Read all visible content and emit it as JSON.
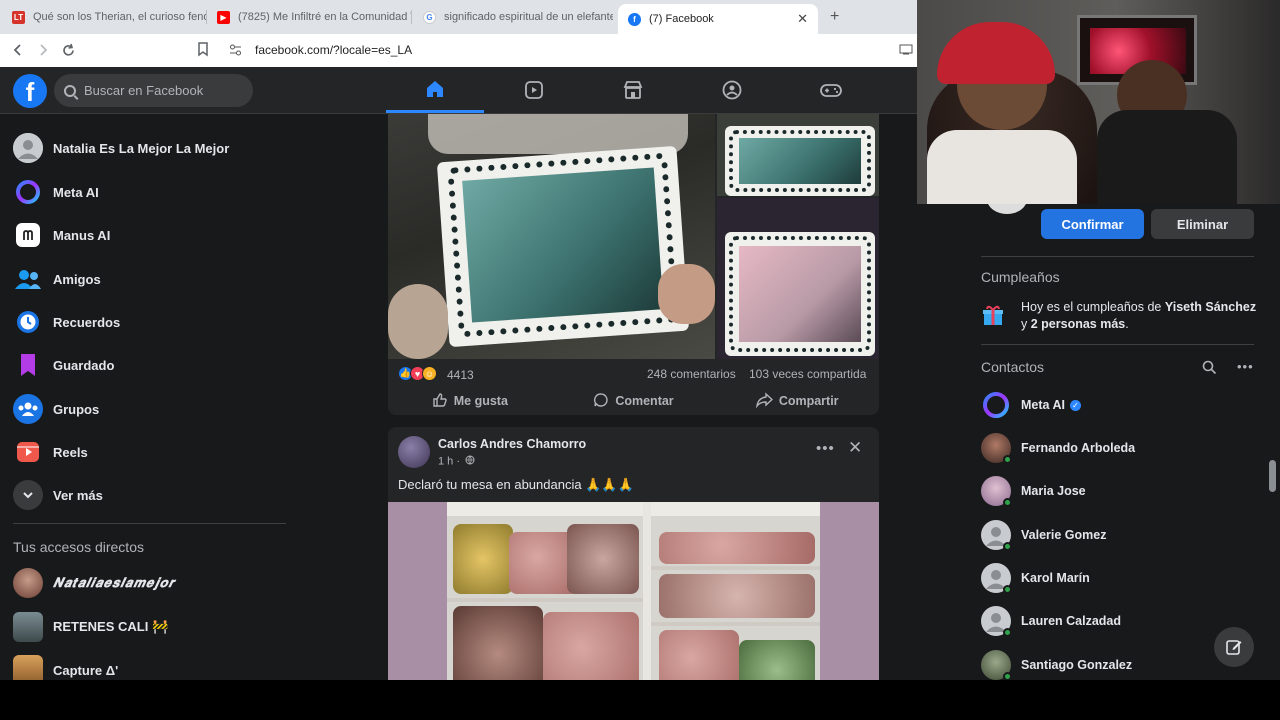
{
  "browser": {
    "tabs": [
      {
        "title": "Qué son los Therian, el curioso fenó",
        "favicon": "LT"
      },
      {
        "title": "(7825) Me Infiltré en la Comunidad T",
        "favicon": "youtube"
      },
      {
        "title": "significado espiritual de un elefante",
        "favicon": "google"
      },
      {
        "title": "(7) Facebook",
        "favicon": "facebook"
      }
    ],
    "url": "facebook.com/?locale=es_LA"
  },
  "fb": {
    "search_placeholder": "Buscar en Facebook",
    "nav": [
      "home-icon",
      "video-icon",
      "marketplace-icon",
      "groups-icon",
      "gaming-icon"
    ]
  },
  "sidebar": {
    "items": [
      {
        "label": "Natalia Es La Mejor La Mejor",
        "icon": "profile-avatar"
      },
      {
        "label": "Meta AI",
        "icon": "meta-ai-icon"
      },
      {
        "label": "Manus AI",
        "icon": "manus-icon"
      },
      {
        "label": "Amigos",
        "icon": "friends-icon"
      },
      {
        "label": "Recuerdos",
        "icon": "memories-icon"
      },
      {
        "label": "Guardado",
        "icon": "saved-icon"
      },
      {
        "label": "Grupos",
        "icon": "groups-icon"
      },
      {
        "label": "Reels",
        "icon": "reels-icon"
      },
      {
        "label": "Ver más",
        "icon": "chevron-down-icon"
      }
    ],
    "shortcuts_heading": "Tus accesos directos",
    "shortcuts": [
      {
        "label": "𝑵𝒂𝒕𝒂𝒍𝒊𝒂𝒆𝒔𝒍𝒂𝒎𝒆𝒋𝒐𝒓"
      },
      {
        "label": "RETENES CALI 🚧"
      },
      {
        "label": "Capture Δ'"
      }
    ]
  },
  "post1": {
    "reaction_count": "4413",
    "comments": "248 comentarios",
    "shares": "103 veces compartida",
    "actions": {
      "like": "Me gusta",
      "comment": "Comentar",
      "share": "Compartir"
    }
  },
  "post2": {
    "author": "Carlos Andres Chamorro",
    "time": "1 h ·",
    "caption": "Declaró tu mesa en abundancia 🙏🙏🙏"
  },
  "right": {
    "confirm": "Confirmar",
    "delete": "Eliminar",
    "birthdays_heading": "Cumpleaños",
    "birthday_text_prefix": "Hoy es el cumpleaños de ",
    "birthday_name": "Yiseth Sánchez",
    "birthday_mid": "y ",
    "birthday_others": "2 personas más",
    "birthday_suffix": ".",
    "contacts_heading": "Contactos",
    "contacts": [
      {
        "name": "Meta AI",
        "online": false,
        "verified": true
      },
      {
        "name": "Fernando Arboleda",
        "online": true
      },
      {
        "name": "Maria Jose",
        "online": true
      },
      {
        "name": "Valerie Gomez",
        "online": true
      },
      {
        "name": "Karol Marín",
        "online": true
      },
      {
        "name": "Lauren Calzadad",
        "online": true
      },
      {
        "name": "Santiago Gonzalez",
        "online": true
      }
    ]
  },
  "colors": {
    "accent": "#1877f2",
    "bg": "#18191a",
    "card": "#242526",
    "online": "#31a24c"
  }
}
